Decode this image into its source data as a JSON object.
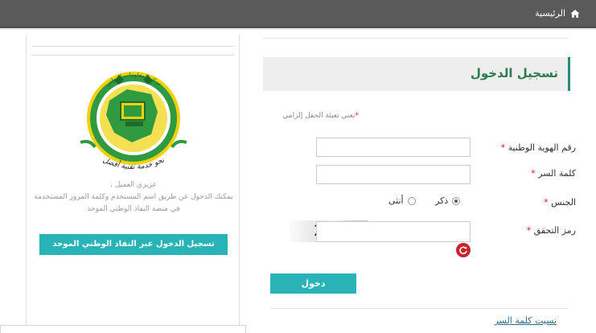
{
  "breadcrumb": {
    "home_label": "الرئيسية",
    "home_icon": "home-icon"
  },
  "login": {
    "title": "تسجيل الدخول",
    "required_note": "تعني تعبئة الحقل إلزامي",
    "required_marker": "*",
    "fields": {
      "national_id": {
        "label": "رقم الهوية الوطنية",
        "value": "",
        "placeholder": ""
      },
      "password": {
        "label": "كلمة السر",
        "value": "",
        "placeholder": ""
      },
      "captcha": {
        "label": "رمز التحقق",
        "value": "",
        "placeholder": ""
      }
    },
    "gender": {
      "label": "الجنس",
      "options": [
        {
          "label": "ذكر",
          "checked": true
        },
        {
          "label": "أنثى",
          "checked": false
        }
      ]
    },
    "captcha_image_text": "21050",
    "submit_label": "دخول",
    "forgot_password_label": "نسيت كلمة السر"
  },
  "nafath": {
    "greeting": "عزيزي العميل ،",
    "description_line1": "يمكنك الدخول عن طريق اسم المستخدم وكلمة المرور المستخدمة",
    "description_line2": "في منصة النفاذ الوطني الموحد",
    "button_label": "تسجيل الدخول عبر النفاذ الوطني الموحد"
  },
  "logo": {
    "outer_text": "نحو خدمة تقنية أفضل",
    "inner_text": "مركز المعلومات الوطني"
  },
  "bottom_popup": {
    "text": ""
  },
  "colors": {
    "accent": "#2ab3b6",
    "title_green": "#2c7b53",
    "required_red": "#d41a1a",
    "topbar": "#5a5a5a",
    "logo_green": "#2f9a3f",
    "logo_gold": "#f1d10b"
  }
}
